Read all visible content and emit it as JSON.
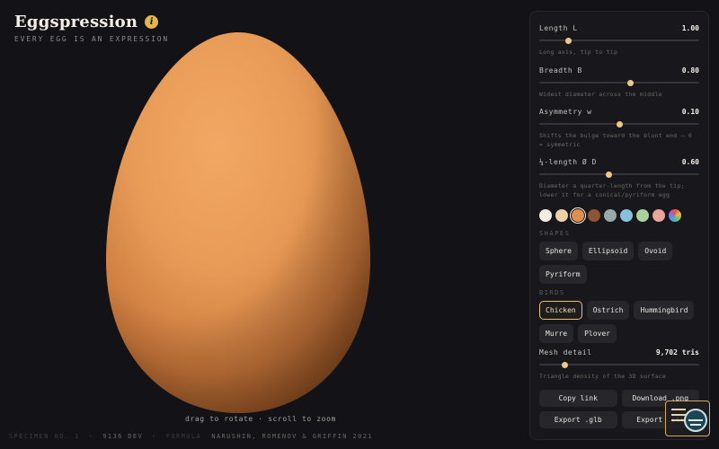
{
  "app": {
    "title": "Eggspression",
    "subtitle": "EVERY EGG IS AN EXPRESSION"
  },
  "viewport": {
    "hint": "drag to rotate · scroll to zoom",
    "egg_color": "#e59a55"
  },
  "footer": {
    "specimen": "SPECIMEN NO. 1",
    "tris_dev": "9136 DEV",
    "formula_label": "FORMULA",
    "credits": "NARUSHIN, ROMENOV & GRIFFIN 2021"
  },
  "sliders": [
    {
      "label": "Length L",
      "value": "1.00",
      "position": 0.18,
      "desc": "Long axis, tip to tip"
    },
    {
      "label": "Breadth B",
      "value": "0.80",
      "position": 0.57,
      "desc": "Widest diameter across the middle"
    },
    {
      "label": "Asymmetry w",
      "value": "0.10",
      "position": 0.5,
      "desc": "Shifts the bulge toward the blunt end — 0 = symmetric"
    },
    {
      "label": "¼-length Ø D",
      "value": "0.60",
      "position": 0.43,
      "desc": "Diameter a quarter-length from the tip; lower it for a conical/pyriform egg"
    }
  ],
  "swatches": {
    "colors": [
      "#f2ede2",
      "#ecd2a2",
      "#e08e4d",
      "#8e5434",
      "#9aa8ad",
      "#87c2dd",
      "#a9d29c",
      "#e9a59a",
      "conic"
    ],
    "selected_index": 2
  },
  "shapes": {
    "label": "SHAPES",
    "items": [
      "Sphere",
      "Ellipsoid",
      "Ovoid",
      "Pyriform"
    ]
  },
  "birds": {
    "label": "BIRDS",
    "items": [
      "Chicken",
      "Ostrich",
      "Hummingbird",
      "Murre",
      "Plover"
    ],
    "active_index": 0
  },
  "mesh": {
    "label": "Mesh detail",
    "value": "9,702 tris",
    "position": 0.16,
    "desc": "Triangle density of the 3D surface"
  },
  "buttons": {
    "copy_link": "Copy link",
    "download_png": "Download .png",
    "export_glb": "Export .glb",
    "export_stl": "Export .stl"
  }
}
